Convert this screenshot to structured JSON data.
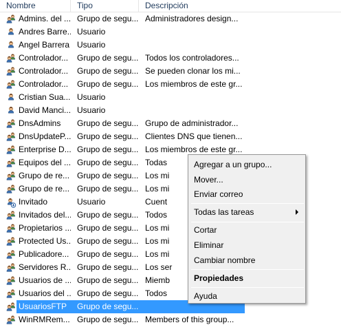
{
  "columns": [
    "Nombre",
    "Tipo",
    "Descripción"
  ],
  "rows": [
    {
      "name": "Admins. del ...",
      "type": "Grupo de segu...",
      "desc": "Administradores design...",
      "icon": "group-icon"
    },
    {
      "name": "Andres Barre...",
      "type": "Usuario",
      "desc": "",
      "icon": "user-icon"
    },
    {
      "name": "Angel Barrera",
      "type": "Usuario",
      "desc": "",
      "icon": "user-icon"
    },
    {
      "name": "Controlador...",
      "type": "Grupo de segu...",
      "desc": "Todos los controladores...",
      "icon": "group-icon"
    },
    {
      "name": "Controlador...",
      "type": "Grupo de segu...",
      "desc": "Se pueden clonar los mi...",
      "icon": "group-icon"
    },
    {
      "name": "Controlador...",
      "type": "Grupo de segu...",
      "desc": "Los miembros de este gr...",
      "icon": "group-icon"
    },
    {
      "name": "Cristian Sua...",
      "type": "Usuario",
      "desc": "",
      "icon": "user-icon"
    },
    {
      "name": "David Manci...",
      "type": "Usuario",
      "desc": "",
      "icon": "user-icon"
    },
    {
      "name": "DnsAdmins",
      "type": "Grupo de segu...",
      "desc": "Grupo de administrador...",
      "icon": "group-icon"
    },
    {
      "name": "DnsUpdateP...",
      "type": "Grupo de segu...",
      "desc": "Clientes DNS que tienen...",
      "icon": "group-icon"
    },
    {
      "name": "Enterprise D...",
      "type": "Grupo de segu...",
      "desc": "Los miembros de este gr...",
      "icon": "group-icon"
    },
    {
      "name": "Equipos del ...",
      "type": "Grupo de segu...",
      "desc": "Todas",
      "icon": "group-icon"
    },
    {
      "name": "Grupo de re...",
      "type": "Grupo de segu...",
      "desc": "Los mi",
      "icon": "group-icon"
    },
    {
      "name": "Grupo de re...",
      "type": "Grupo de segu...",
      "desc": "Los mi",
      "icon": "group-icon"
    },
    {
      "name": "Invitado",
      "type": "Usuario",
      "desc": "Cuent",
      "icon": "user-disabled-icon"
    },
    {
      "name": "Invitados del...",
      "type": "Grupo de segu...",
      "desc": "Todos",
      "icon": "group-icon"
    },
    {
      "name": "Propietarios ...",
      "type": "Grupo de segu...",
      "desc": "Los mi",
      "icon": "group-icon"
    },
    {
      "name": "Protected Us...",
      "type": "Grupo de segu...",
      "desc": "Los mi",
      "icon": "group-icon"
    },
    {
      "name": "Publicadore...",
      "type": "Grupo de segu...",
      "desc": "Los mi",
      "icon": "group-icon"
    },
    {
      "name": "Servidores R...",
      "type": "Grupo de segu...",
      "desc": "Los ser",
      "icon": "group-icon"
    },
    {
      "name": "Usuarios de ...",
      "type": "Grupo de segu...",
      "desc": "Miemb",
      "icon": "group-icon"
    },
    {
      "name": "Usuarios del ...",
      "type": "Grupo de segu...",
      "desc": "Todos",
      "icon": "group-icon"
    },
    {
      "name": "UsuariosFTP",
      "type": "Grupo de segu...",
      "desc": "",
      "icon": "group-icon",
      "selected": true
    },
    {
      "name": "WinRMRem...",
      "type": "Grupo de segu...",
      "desc": "Members of this group...",
      "icon": "group-icon"
    }
  ],
  "context_menu": {
    "items": [
      {
        "label": "Agregar a un grupo...",
        "bold": false
      },
      {
        "label": "Mover...",
        "bold": false
      },
      {
        "label": "Enviar correo",
        "bold": false
      },
      {
        "label": "Todas las tareas",
        "bold": false,
        "submenu": true
      },
      {
        "label": "Cortar",
        "bold": false
      },
      {
        "label": "Eliminar",
        "bold": false
      },
      {
        "label": "Cambiar nombre",
        "bold": false
      },
      {
        "label": "Propiedades",
        "bold": true
      },
      {
        "label": "Ayuda",
        "bold": false
      }
    ]
  },
  "colors": {
    "selection": "#3399ff",
    "header_text": "#1e395b",
    "menu_bg": "#f0f0f0"
  }
}
